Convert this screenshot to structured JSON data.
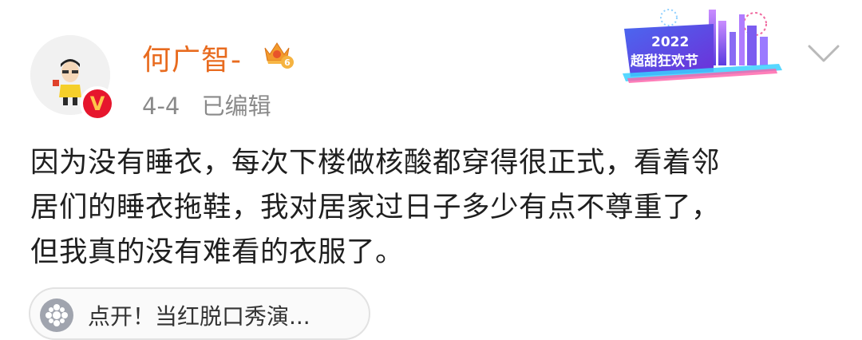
{
  "post": {
    "username": "何广智-",
    "vip_level": "6",
    "date": "4-4",
    "edited_label": "已编辑",
    "text_lines": [
      "因为没有睡衣，每次下楼做核酸都穿得很正式，看着邻",
      "居们的睡衣拖鞋，我对居家过日子多少有点不尊重了，",
      "但我真的没有难看的衣服了。"
    ],
    "verified_badge": "V"
  },
  "banner": {
    "year": "2022",
    "title": "超甜狂欢节"
  },
  "link_card": {
    "text": "点开！当红脱口秀演..."
  },
  "colors": {
    "username": "#e86b1f",
    "meta": "#8a8a8a",
    "text": "#1f1f1f",
    "verified": "#e6162d"
  },
  "icons": {
    "menu": "chevron-down-icon",
    "link": "film-reel-icon",
    "vip": "crown-icon"
  }
}
